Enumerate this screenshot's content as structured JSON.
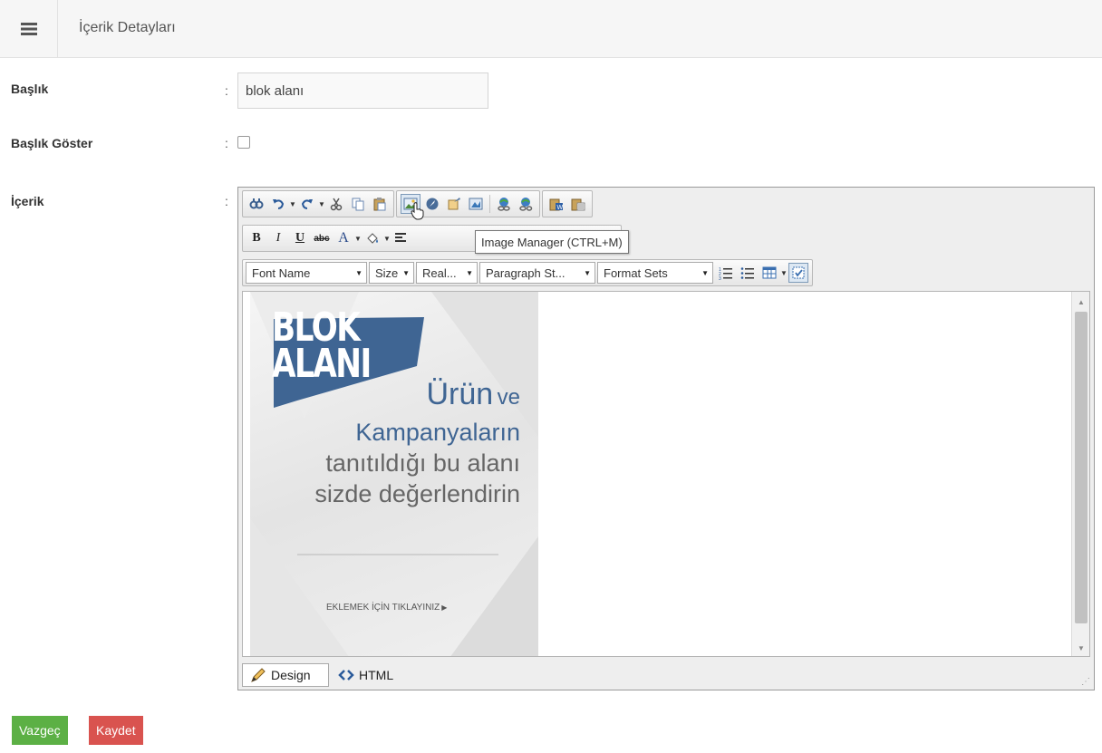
{
  "header": {
    "title": "İçerik Detayları",
    "menu_icon": "hamburger-menu-icon"
  },
  "form": {
    "title_label": "Başlık",
    "title_value": "blok alanı",
    "show_title_label": "Başlık Göster",
    "show_title_checked": false,
    "content_label": "İçerik",
    "colon": ":"
  },
  "editor": {
    "tooltip": "Image Manager (CTRL+M)",
    "dropdowns": {
      "font_name": "Font Name",
      "size": "Size",
      "real": "Real...",
      "paragraph": "Paragraph St...",
      "format_sets": "Format Sets"
    },
    "format_buttons": {
      "bold": "B",
      "italic": "I",
      "underline": "U",
      "strike": "abc",
      "font_color": "A"
    },
    "modes": {
      "design": "Design",
      "html": "HTML"
    }
  },
  "banner": {
    "logo_line1": "BLOK",
    "logo_line2": "ALANI",
    "word_urun": "Ürün",
    "word_ve": "ve",
    "line_kampanya": "Kampanyaların",
    "line_tanitildi": "tanıtıldığı bu alanı",
    "line_sizde": "sizde değerlendirin",
    "cta": "EKLEMEK İÇİN TIKLAYINIZ",
    "accent_color": "#3f6593"
  },
  "actions": {
    "cancel": "Vazgeç",
    "save": "Kaydet"
  }
}
